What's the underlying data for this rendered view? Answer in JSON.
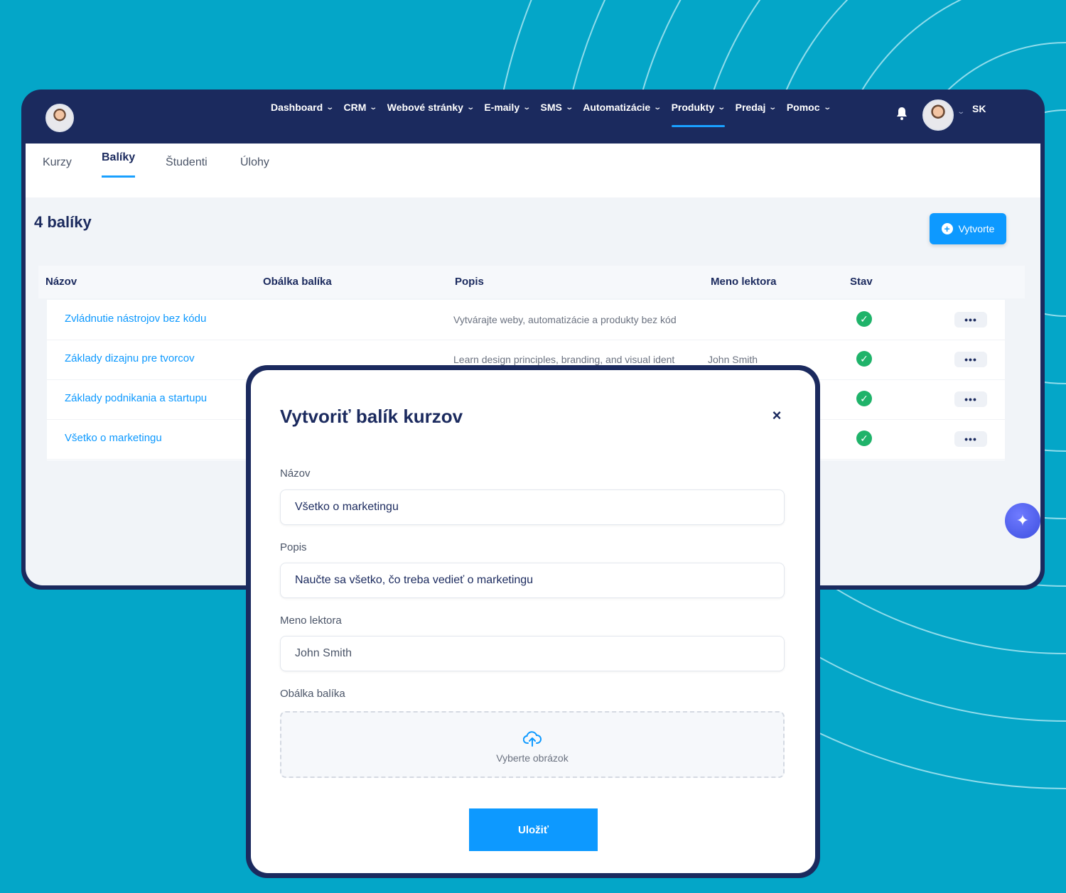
{
  "nav": {
    "items": [
      {
        "label": "Dashboard"
      },
      {
        "label": "CRM"
      },
      {
        "label": "Webové stránky"
      },
      {
        "label": "E-maily"
      },
      {
        "label": "SMS"
      },
      {
        "label": "Automatizácie"
      },
      {
        "label": "Produkty",
        "active": true
      },
      {
        "label": "Predaj"
      },
      {
        "label": "Pomoc"
      }
    ],
    "language": "SK"
  },
  "tabs": [
    {
      "label": "Kurzy"
    },
    {
      "label": "Balíky",
      "active": true
    },
    {
      "label": "Študenti"
    },
    {
      "label": "Úlohy"
    }
  ],
  "page": {
    "title": "4 balíky",
    "create_label": "Vytvorte"
  },
  "table": {
    "columns": [
      "Názov",
      "Obálka balíka",
      "Popis",
      "Meno lektora",
      "Stav"
    ],
    "rows": [
      {
        "name": "Zvládnutie nástrojov bez kódu",
        "description": "Vytvárajte weby, automatizácie a produkty bez kód",
        "lecturer": "",
        "status": "active"
      },
      {
        "name": "Základy dizajnu pre tvorcov",
        "description": "Learn design principles, branding, and visual ident",
        "lecturer": "John Smith",
        "status": "active"
      },
      {
        "name": "Základy podnikania a startupu",
        "description": "",
        "lecturer": "",
        "status": "active"
      },
      {
        "name": "Všetko o marketingu",
        "description": "",
        "lecturer": "",
        "status": "active"
      }
    ],
    "more_label": "•••"
  },
  "modal": {
    "title": "Vytvoriť balík kurzov",
    "close_label": "×",
    "name_label": "Názov",
    "name_value": "Všetko o marketingu",
    "description_label": "Popis",
    "description_value": "Naučte sa všetko, čo treba vedieť o marketingu",
    "lecturer_label": "Meno lektora",
    "lecturer_value": "John Smith",
    "cover_label": "Obálka balíka",
    "cover_placeholder": "Vyberte obrázok",
    "save_label": "Uložiť"
  },
  "colors": {
    "background": "#04a6c8",
    "navy": "#1b2a5e",
    "accent": "#0d99ff",
    "success": "#1fb36a"
  }
}
